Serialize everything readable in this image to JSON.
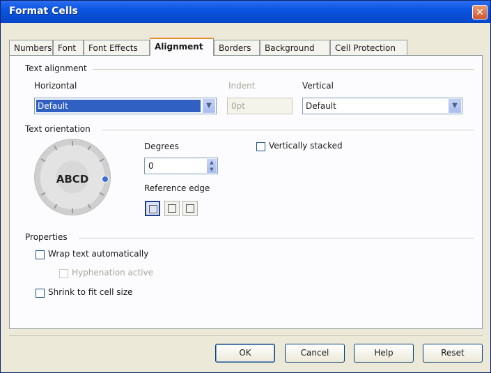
{
  "window": {
    "title": "Format Cells",
    "close_glyph": "✕"
  },
  "tabs": [
    {
      "label": "Numbers"
    },
    {
      "label": "Font"
    },
    {
      "label": "Font Effects"
    },
    {
      "label": "Alignment"
    },
    {
      "label": "Borders"
    },
    {
      "label": "Background"
    },
    {
      "label": "Cell Protection"
    }
  ],
  "active_tab": "Alignment",
  "text_alignment": {
    "group_label": "Text alignment",
    "horizontal": {
      "label": "Horizontal",
      "value": "Default"
    },
    "indent": {
      "label": "Indent",
      "value": "0pt"
    },
    "vertical": {
      "label": "Vertical",
      "value": "Default"
    }
  },
  "text_orientation": {
    "group_label": "Text orientation",
    "dial_text": "ABCD",
    "degrees": {
      "label": "Degrees",
      "value": "0"
    },
    "reference_edge": {
      "label": "Reference edge"
    },
    "vertically_stacked": {
      "label": "Vertically stacked",
      "checked": false
    }
  },
  "properties": {
    "group_label": "Properties",
    "wrap_text": {
      "label": "Wrap text automatically",
      "checked": false
    },
    "hyphenation": {
      "label": "Hyphenation active",
      "checked": false,
      "enabled": false
    },
    "shrink_to_fit": {
      "label": "Shrink to fit cell size",
      "checked": false
    }
  },
  "buttons": {
    "ok": "OK",
    "cancel": "Cancel",
    "help": "Help",
    "reset": "Reset"
  },
  "icons": {
    "dropdown_arrow": "▼",
    "spin_up": "▲",
    "spin_down": "▼"
  }
}
